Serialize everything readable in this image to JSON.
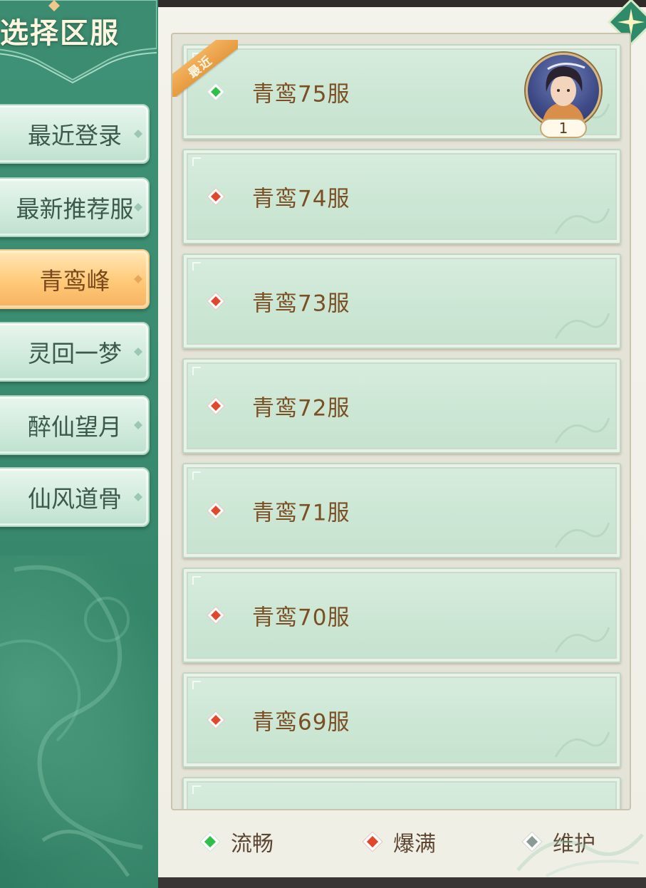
{
  "title": "选择区服",
  "categories": [
    {
      "label": "最近登录",
      "active": false
    },
    {
      "label": "最新推荐服",
      "active": false
    },
    {
      "label": "青鸾峰",
      "active": true
    },
    {
      "label": "灵回一梦",
      "active": false
    },
    {
      "label": "醉仙望月",
      "active": false
    },
    {
      "label": "仙风道骨",
      "active": false
    }
  ],
  "servers": [
    {
      "name": "青鸾75服",
      "status": "smooth",
      "recent_tag": "最近",
      "character_count": "1"
    },
    {
      "name": "青鸾74服",
      "status": "full"
    },
    {
      "name": "青鸾73服",
      "status": "full"
    },
    {
      "name": "青鸾72服",
      "status": "full"
    },
    {
      "name": "青鸾71服",
      "status": "full"
    },
    {
      "name": "青鸾70服",
      "status": "full"
    },
    {
      "name": "青鸾69服",
      "status": "full"
    }
  ],
  "legend": [
    {
      "label": "流畅",
      "status": "smooth"
    },
    {
      "label": "爆满",
      "status": "full"
    },
    {
      "label": "维护",
      "status": "maintenance"
    }
  ],
  "colors": {
    "smooth": "#2fbf4a",
    "full": "#e0472c",
    "maintenance": "#8a9a94",
    "active_tab": "#ffc978",
    "sidebar": "#3a8b6f"
  }
}
